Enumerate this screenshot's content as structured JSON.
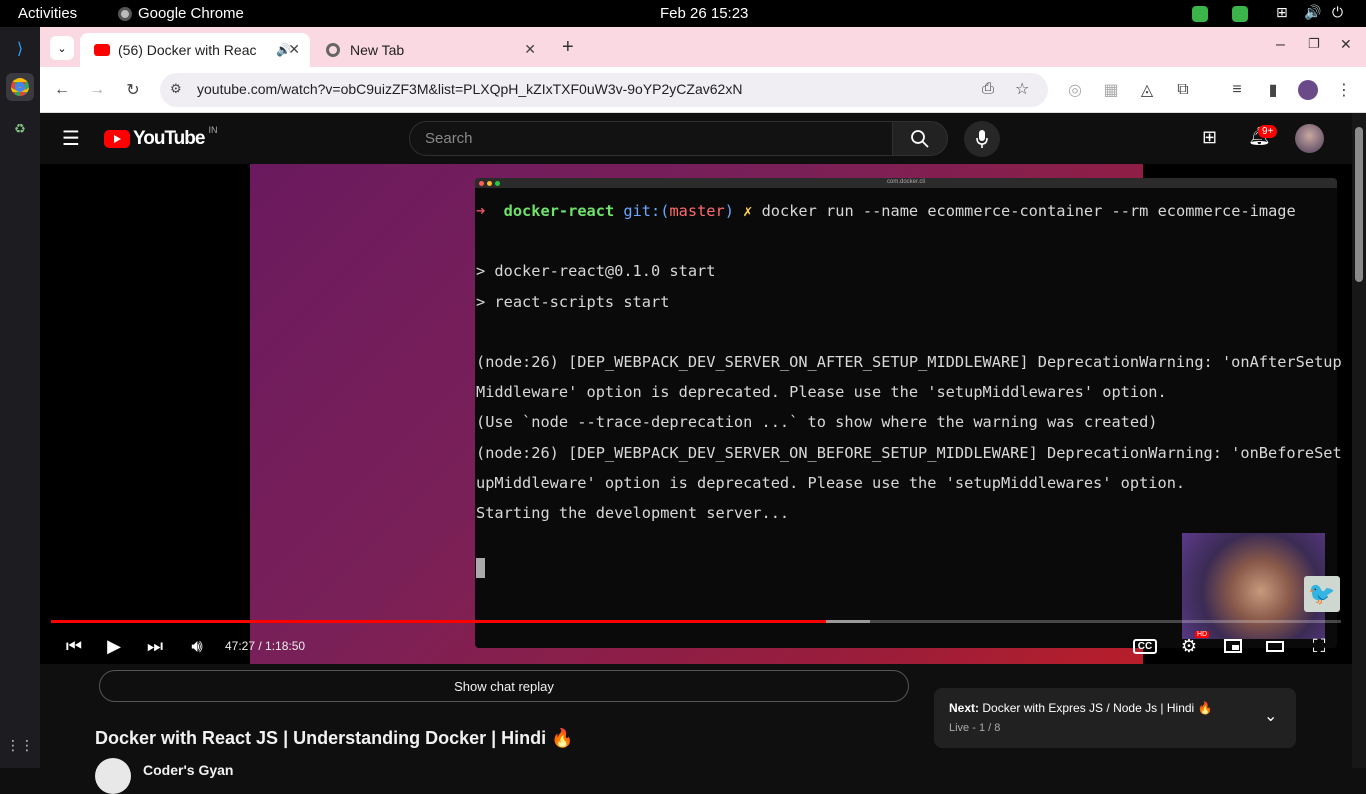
{
  "system": {
    "activities": "Activities",
    "app_name": "Google Chrome",
    "clock": "Feb 26  15:23"
  },
  "browser": {
    "tabs": [
      {
        "label": "(56) Docker with Reac",
        "active": true
      },
      {
        "label": "New Tab",
        "active": false
      }
    ],
    "url": "youtube.com/watch?v=obC9uizZF3M&list=PLXQpH_kZIxTXF0uW3v-9oYP2yCZav62xN"
  },
  "youtube": {
    "logo_text": "YouTube",
    "region": "IN",
    "search_placeholder": "Search",
    "notifications_badge": "9+"
  },
  "terminal": {
    "window_title": "com.docker.cli",
    "prompt_arrow": "➜",
    "prompt_dir": "docker-react",
    "prompt_git": "git:(",
    "prompt_branch": "master",
    "prompt_git_close": ")",
    "prompt_dirty": "✗",
    "command": "docker run --name ecommerce-container --rm ecommerce-image",
    "lines": [
      "",
      "> docker-react@0.1.0 start",
      "> react-scripts start",
      "",
      "(node:26) [DEP_WEBPACK_DEV_SERVER_ON_AFTER_SETUP_MIDDLEWARE] DeprecationWarning: 'onAfterSetup",
      "Middleware' option is deprecated. Please use the 'setupMiddlewares' option.",
      "(Use `node --trace-deprecation ...` to show where the warning was created)",
      "(node:26) [DEP_WEBPACK_DEV_SERVER_ON_BEFORE_SETUP_MIDDLEWARE] DeprecationWarning: 'onBeforeSet",
      "upMiddleware' option is deprecated. Please use the 'setupMiddlewares' option.",
      "Starting the development server..."
    ]
  },
  "player": {
    "time_display": "47:27 / 1:18:50",
    "played_fraction": 0.601,
    "buffered_fraction": 0.635,
    "hd_badge": "HD"
  },
  "below": {
    "chat_replay": "Show chat replay",
    "next_label": "Next:",
    "next_title": "Docker with Expres JS / Node Js | Hindi 🔥",
    "next_sub": "Live - 1 / 8",
    "video_title": "Docker with React JS | Understanding Docker | Hindi 🔥",
    "channel_name": "Coder's Gyan"
  },
  "colors": {
    "tabstrip": "#fbd9e3",
    "progress": "#ff0000",
    "youtube_red": "#ff0000"
  }
}
